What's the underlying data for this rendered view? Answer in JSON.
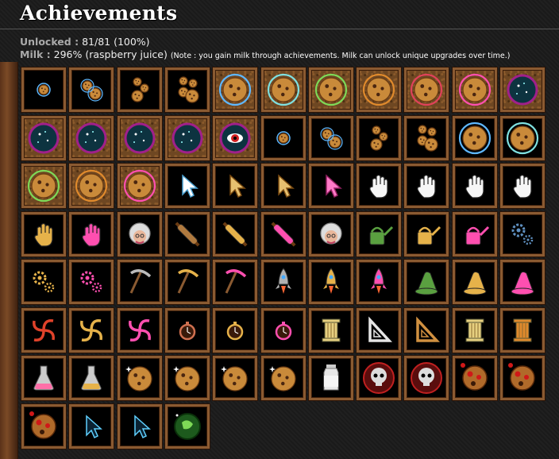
{
  "header": {
    "title": "Achievements"
  },
  "stats": {
    "unlocked_label": "Unlocked :",
    "unlocked_value": "81/81 (100%)",
    "milk_label": "Milk :",
    "milk_value": "296% (raspberry juice)",
    "milk_note": "(Note : you gain milk through achievements. Milk can unlock unique upgrades over time.)"
  },
  "achievements": [
    {
      "icon": "cookie-1",
      "wood": false
    },
    {
      "icon": "cookie-2",
      "wood": false
    },
    {
      "icon": "cookie-3",
      "wood": false
    },
    {
      "icon": "cookie-4",
      "wood": false
    },
    {
      "icon": "cookie-ring-blue",
      "wood": true
    },
    {
      "icon": "cookie-ring-cyan",
      "wood": true
    },
    {
      "icon": "cookie-ring-green",
      "wood": true
    },
    {
      "icon": "cookie-ring-orange",
      "wood": true
    },
    {
      "icon": "cookie-ring-red",
      "wood": true
    },
    {
      "icon": "cookie-ring-pink",
      "wood": true
    },
    {
      "icon": "galaxy-orb",
      "wood": true
    },
    {
      "icon": "galaxy-orb",
      "wood": true
    },
    {
      "icon": "galaxy-orb",
      "wood": true
    },
    {
      "icon": "galaxy-orb",
      "wood": true
    },
    {
      "icon": "galaxy-orb",
      "wood": true
    },
    {
      "icon": "eye-orb",
      "wood": true
    },
    {
      "icon": "cookie-1",
      "wood": false
    },
    {
      "icon": "cookie-2",
      "wood": false
    },
    {
      "icon": "cookie-3",
      "wood": false
    },
    {
      "icon": "cookie-4",
      "wood": false
    },
    {
      "icon": "cookie-ring-blue",
      "wood": false
    },
    {
      "icon": "cookie-ring-cyan",
      "wood": false
    },
    {
      "icon": "cookie-ring-green",
      "wood": true
    },
    {
      "icon": "cookie-ring-orange",
      "wood": true
    },
    {
      "icon": "cookie-ring-pink",
      "wood": true
    },
    {
      "icon": "cursor-white",
      "wood": false
    },
    {
      "icon": "cursor-gold",
      "wood": false
    },
    {
      "icon": "cursor-gold",
      "wood": false
    },
    {
      "icon": "cursor-pink",
      "wood": false
    },
    {
      "icon": "hand-white",
      "wood": false
    },
    {
      "icon": "hand-white",
      "wood": false
    },
    {
      "icon": "hand-white",
      "wood": false
    },
    {
      "icon": "hand-white",
      "wood": false
    },
    {
      "icon": "hand-gold",
      "wood": false
    },
    {
      "icon": "hand-pink",
      "wood": false
    },
    {
      "icon": "grandma",
      "wood": false
    },
    {
      "icon": "rolling-pin-brown",
      "wood": false
    },
    {
      "icon": "rolling-pin-gold",
      "wood": false
    },
    {
      "icon": "rolling-pin-pink",
      "wood": false
    },
    {
      "icon": "grandma",
      "wood": false
    },
    {
      "icon": "watering-can-green",
      "wood": false
    },
    {
      "icon": "watering-can-gold",
      "wood": false
    },
    {
      "icon": "watering-can-pink",
      "wood": false
    },
    {
      "icon": "gears-blue",
      "wood": false
    },
    {
      "icon": "gears-gold",
      "wood": false
    },
    {
      "icon": "gears-pink",
      "wood": false
    },
    {
      "icon": "pickaxe-gray",
      "wood": false
    },
    {
      "icon": "pickaxe-gold",
      "wood": false
    },
    {
      "icon": "pickaxe-pink",
      "wood": false
    },
    {
      "icon": "rocket-gray",
      "wood": false
    },
    {
      "icon": "rocket-gold",
      "wood": false
    },
    {
      "icon": "rocket-pink",
      "wood": false
    },
    {
      "icon": "wizard-hat-green",
      "wood": false
    },
    {
      "icon": "wizard-hat-gold",
      "wood": false
    },
    {
      "icon": "wizard-hat-pink",
      "wood": false
    },
    {
      "icon": "portal-red",
      "wood": false
    },
    {
      "icon": "portal-gold",
      "wood": false
    },
    {
      "icon": "portal-pink",
      "wood": false
    },
    {
      "icon": "stopwatch-red",
      "wood": false
    },
    {
      "icon": "stopwatch-gold",
      "wood": false
    },
    {
      "icon": "stopwatch-pink",
      "wood": false
    },
    {
      "icon": "pillar-gold",
      "wood": false
    },
    {
      "icon": "set-square-white",
      "wood": false
    },
    {
      "icon": "set-square-gold",
      "wood": false
    },
    {
      "icon": "pillar-gold",
      "wood": false
    },
    {
      "icon": "pillar-orange",
      "wood": false
    },
    {
      "icon": "flask-pink",
      "wood": false
    },
    {
      "icon": "flask-gold",
      "wood": false
    },
    {
      "icon": "cookie-sparkle",
      "wood": false
    },
    {
      "icon": "cookie-sparkle",
      "wood": false
    },
    {
      "icon": "cookie-sparkle",
      "wood": false
    },
    {
      "icon": "cookie-sparkle",
      "wood": false
    },
    {
      "icon": "milk-bottle",
      "wood": false
    },
    {
      "icon": "skull-red",
      "wood": false
    },
    {
      "icon": "skull-red",
      "wood": false
    },
    {
      "icon": "cookie-burnt",
      "wood": false
    },
    {
      "icon": "cookie-burnt",
      "wood": false
    },
    {
      "icon": "cookie-burnt",
      "wood": false
    },
    {
      "icon": "cursor-blue-outline",
      "wood": false
    },
    {
      "icon": "cursor-blue-outline",
      "wood": false
    },
    {
      "icon": "green-orb",
      "wood": false
    }
  ]
}
